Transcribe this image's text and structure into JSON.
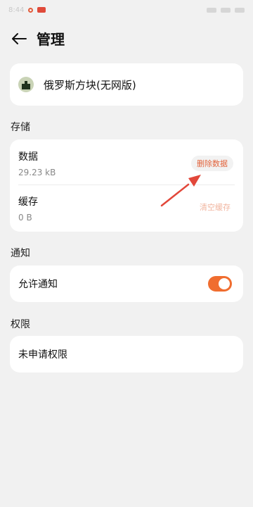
{
  "status_bar": {
    "time": "8:44"
  },
  "header": {
    "title": "管理"
  },
  "app": {
    "name": "俄罗斯方块(无网版)"
  },
  "storage": {
    "section_label": "存储",
    "data_label": "数据",
    "data_size": "29.23 kB",
    "delete_data_button": "删除数据",
    "cache_label": "缓存",
    "cache_size": "0 B",
    "clear_cache_button": "清空缓存"
  },
  "notifications": {
    "section_label": "通知",
    "allow_label": "允许通知",
    "allow_enabled": true
  },
  "permissions": {
    "section_label": "权限",
    "none_label": "未申请权限"
  },
  "colors": {
    "accent": "#f06d2f",
    "annotation_arrow": "#e2473a"
  }
}
